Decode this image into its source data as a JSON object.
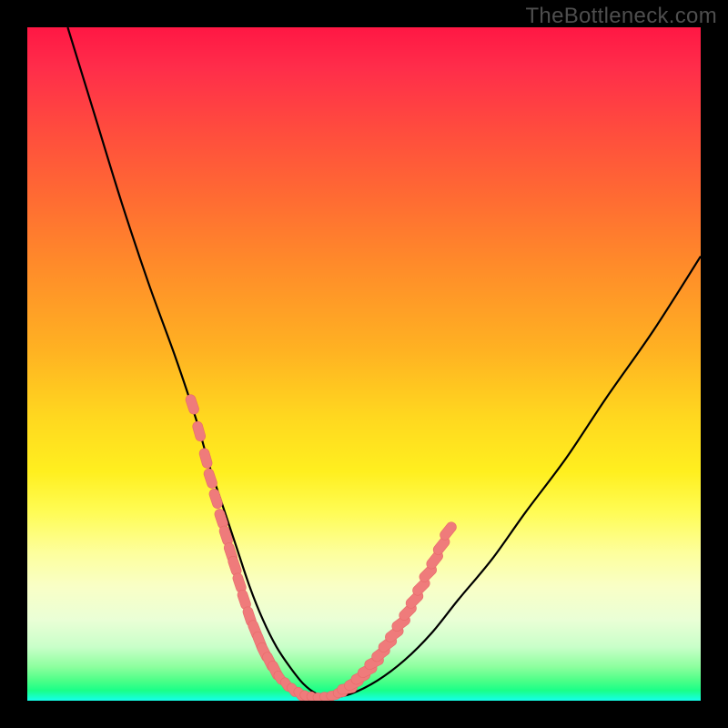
{
  "watermark": "TheBottleneck.com",
  "colors": {
    "frame_bg": "#000000",
    "curve_stroke": "#000000",
    "marker_fill": "#ef7b7b",
    "marker_stroke": "#e86a6a",
    "gradient_top": "#ff1744",
    "gradient_bottom": "#15ffeb"
  },
  "chart_data": {
    "type": "line",
    "title": "",
    "xlabel": "",
    "ylabel": "",
    "xlim": [
      0,
      100
    ],
    "ylim": [
      0,
      100
    ],
    "grid": false,
    "legend": false,
    "notes": "V-shaped bottleneck curve over a vertical red→green gradient. Black line with salmon dash markers along the lower arms. No axis ticks or labels rendered.",
    "series": [
      {
        "name": "bottleneck-curve",
        "x": [
          6,
          10,
          14,
          18,
          22,
          25,
          27,
          29,
          31,
          33,
          35,
          37,
          39,
          41,
          43,
          45,
          48,
          52,
          56,
          60,
          64,
          69,
          74,
          80,
          86,
          93,
          100
        ],
        "y": [
          100,
          87,
          74,
          62,
          51,
          42,
          35,
          29,
          23,
          17,
          12,
          8,
          5,
          2.5,
          1,
          0.5,
          1,
          3,
          6,
          10,
          15,
          21,
          28,
          36,
          45,
          55,
          66
        ]
      }
    ],
    "markers": {
      "name": "curve-markers",
      "style": "capsule",
      "color": "#ef7b7b",
      "points_left": [
        [
          24.5,
          44
        ],
        [
          25.5,
          40
        ],
        [
          26.5,
          36
        ],
        [
          27.2,
          33
        ],
        [
          28.0,
          30
        ],
        [
          28.8,
          27
        ],
        [
          29.5,
          24.5
        ],
        [
          30.2,
          22
        ],
        [
          30.8,
          20
        ],
        [
          31.5,
          17.5
        ],
        [
          32.2,
          15
        ],
        [
          33.0,
          12.5
        ],
        [
          33.8,
          10.5
        ],
        [
          34.5,
          8.8
        ],
        [
          35.2,
          7.2
        ],
        [
          36.0,
          5.8
        ],
        [
          36.8,
          4.5
        ]
      ],
      "points_bottom": [
        [
          37.5,
          3.4
        ],
        [
          38.5,
          2.4
        ],
        [
          39.5,
          1.6
        ],
        [
          40.5,
          1.0
        ],
        [
          41.5,
          0.6
        ],
        [
          42.5,
          0.4
        ],
        [
          43.5,
          0.4
        ],
        [
          44.5,
          0.5
        ],
        [
          45.5,
          0.8
        ],
        [
          46.5,
          1.2
        ]
      ],
      "points_right": [
        [
          47.5,
          1.8
        ],
        [
          48.5,
          2.6
        ],
        [
          49.5,
          3.5
        ],
        [
          50.5,
          4.5
        ],
        [
          51.5,
          5.7
        ],
        [
          52.5,
          7.0
        ],
        [
          53.5,
          8.4
        ],
        [
          54.5,
          9.9
        ],
        [
          55.5,
          11.5
        ],
        [
          56.5,
          13.2
        ],
        [
          57.5,
          15.0
        ],
        [
          58.5,
          16.9
        ],
        [
          59.5,
          18.9
        ],
        [
          60.5,
          20.9
        ],
        [
          61.5,
          23.0
        ],
        [
          62.5,
          25.2
        ]
      ]
    }
  }
}
